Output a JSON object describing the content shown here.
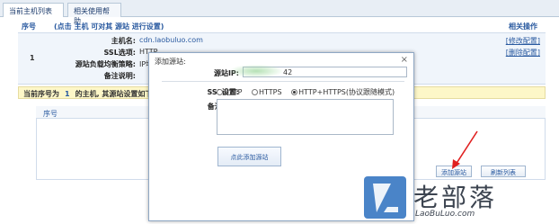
{
  "tabs": [
    "当前主机列表",
    "相关使用帮助"
  ],
  "table": {
    "col_seq": "序号",
    "col_host": "(点击 主机 可对其 源站 进行设置)",
    "col_ops": "相关操作"
  },
  "row": {
    "seq": "1",
    "fields": [
      {
        "label": "主机名:",
        "value": "cdn.laobuluo.com"
      },
      {
        "label": "SSL选项:",
        "value": "HTTP"
      },
      {
        "label": "源站负载均衡策略:",
        "value": "IP地址轮"
      },
      {
        "label": "备注说明:",
        "value": ""
      }
    ],
    "ops": [
      "[修改配置]",
      "[删除配置]"
    ]
  },
  "notice": {
    "prefix": "当前序号为",
    "num": "1",
    "suffix": "的主机, 其源站设置如下"
  },
  "sub": {
    "col_seq": "序号"
  },
  "buttons": {
    "add": "添加源站",
    "refresh": "刷新列表"
  },
  "dialog": {
    "title": "添加源站:",
    "close": "×",
    "ip_label": "源站IP:",
    "ip_value": "42",
    "ssl_label": "SSL设置:",
    "ssl_options": [
      "HTTP",
      "HTTPS",
      "HTTP+HTTPS(协议跟随模式)"
    ],
    "ssl_selected": "HTTP+HTTPS(协议跟随模式)",
    "note_label": "备注说明:",
    "submit": "点此添加源站"
  },
  "watermark": {
    "name": "老部落",
    "domain": "LaoBuLuo.com"
  },
  "colors": {
    "accent": "#2a5aa0",
    "notice_bg": "#fdf7c8",
    "arrow": "#e02020",
    "logo": "#4a84c8"
  }
}
